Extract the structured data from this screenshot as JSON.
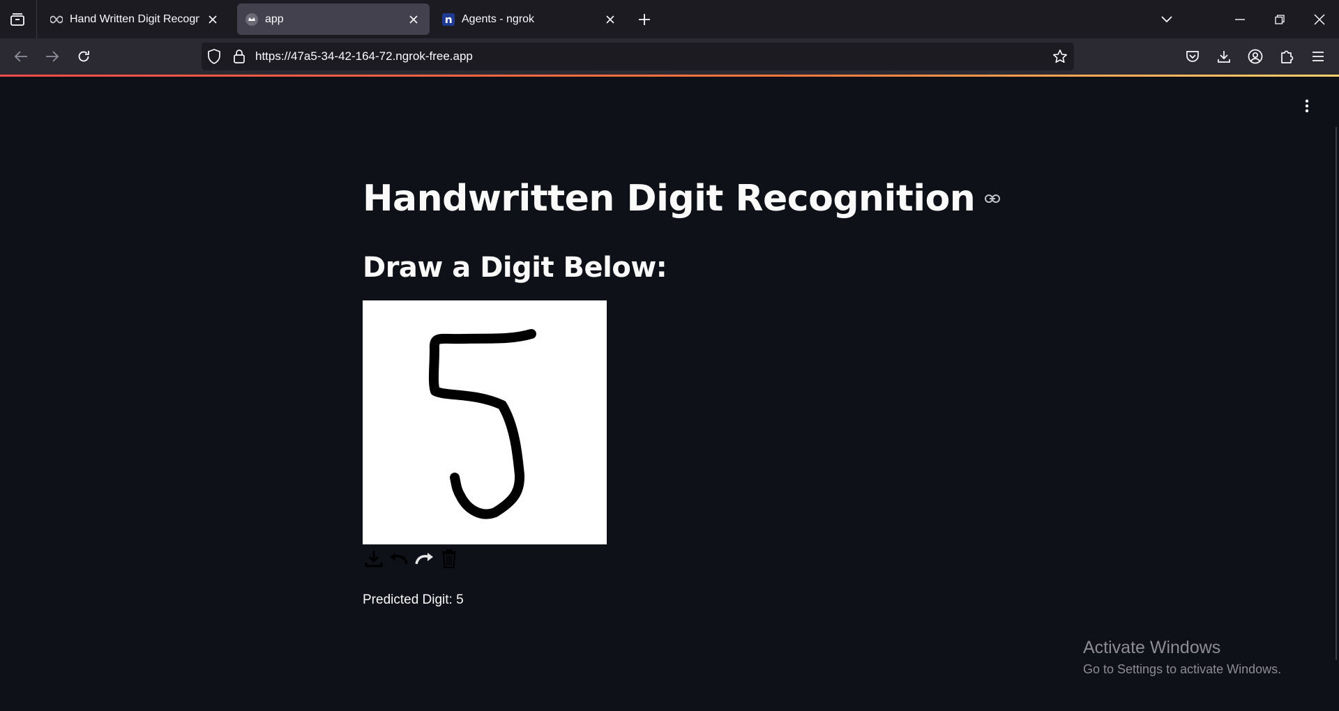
{
  "browser": {
    "tabs": [
      {
        "title": "Hand Written Digit Recognitior",
        "favicon": "infinity-icon",
        "active": false
      },
      {
        "title": "app",
        "favicon": "streamlit-crown-icon",
        "active": true
      },
      {
        "title": "Agents - ngrok",
        "favicon": "ngrok-n-icon",
        "active": false
      }
    ],
    "url": "https://47a5-34-42-164-72.ngrok-free.app",
    "accent_colors": {
      "tabbar": "#1c1b22",
      "navbar": "#2b2a33",
      "active_tab": "#42414d"
    }
  },
  "app": {
    "title": "Handwritten Digit Recognition",
    "subheader": "Draw a Digit Below:",
    "canvas": {
      "drawn_digit": "5",
      "background": "#ffffff",
      "stroke_color": "#000000"
    },
    "toolbar": [
      "download-icon",
      "undo-icon",
      "redo-icon",
      "trash-icon"
    ],
    "prediction_text": "Predicted Digit: 5",
    "background": "#0e1117"
  },
  "watermark": {
    "title": "Activate Windows",
    "subtitle": "Go to Settings to activate Windows."
  }
}
